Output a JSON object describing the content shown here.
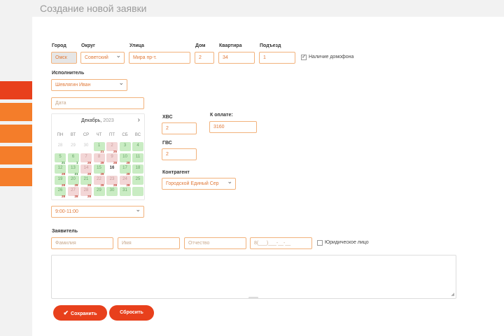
{
  "page": {
    "title": "Создание новой заявки"
  },
  "address": {
    "city": {
      "label": "Город",
      "value": "Омск"
    },
    "district": {
      "label": "Округ",
      "value": "Советский"
    },
    "street": {
      "label": "Улица",
      "value": "Мира пр-т."
    },
    "house": {
      "label": "Дом",
      "value": "2"
    },
    "apartment": {
      "label": "Квартира",
      "value": "34"
    },
    "entrance": {
      "label": "Подъезд",
      "value": "1"
    },
    "intercom": {
      "label": "Наличие домофона",
      "checked": true
    }
  },
  "executor": {
    "label": "Исполнитель",
    "value": "Шевлягин Иван"
  },
  "date_field": {
    "placeholder": "Дата"
  },
  "calendar": {
    "month": "Декабрь,",
    "year": "2023",
    "next": "›",
    "weekdays": [
      "ПН",
      "ВТ",
      "СР",
      "ЧТ",
      "ПТ",
      "СБ",
      "ВС"
    ],
    "weeks": [
      [
        {
          "d": "28",
          "s": "out"
        },
        {
          "d": "29",
          "s": "out"
        },
        {
          "d": "30",
          "s": "out"
        },
        {
          "d": "1",
          "s": "green",
          "n": "21",
          "nc": "r"
        },
        {
          "d": "2",
          "s": "pink",
          "n": "25",
          "nc": "r"
        },
        {
          "d": "3",
          "s": "green"
        },
        {
          "d": "4",
          "s": "green"
        }
      ],
      [
        {
          "d": "5",
          "s": "green",
          "n": "21",
          "nc": "g"
        },
        {
          "d": "6",
          "s": "green",
          "n": "1",
          "nc": "g"
        },
        {
          "d": "7",
          "s": "pink",
          "n": "28",
          "nc": "r"
        },
        {
          "d": "8",
          "s": "pink",
          "n": "28",
          "nc": "r"
        },
        {
          "d": "9",
          "s": "pink",
          "n": "28",
          "nc": "r"
        },
        {
          "d": "10",
          "s": "green",
          "n": "28",
          "nc": "r"
        },
        {
          "d": "11",
          "s": "green"
        }
      ],
      [
        {
          "d": "12",
          "s": "green",
          "n": "28",
          "nc": "r"
        },
        {
          "d": "13",
          "s": "green",
          "n": "21",
          "nc": "g"
        },
        {
          "d": "14",
          "s": "pink",
          "n": "28",
          "nc": "r"
        },
        {
          "d": "15",
          "s": "green",
          "n": "28",
          "nc": "r"
        },
        {
          "d": "16",
          "s": "today"
        },
        {
          "d": "17",
          "s": "green",
          "n": "28",
          "nc": "r"
        },
        {
          "d": "18",
          "s": "green"
        }
      ],
      [
        {
          "d": "19",
          "s": "green",
          "n": "28",
          "nc": "r"
        },
        {
          "d": "20",
          "s": "green",
          "n": "28",
          "nc": "r"
        },
        {
          "d": "21",
          "s": "green",
          "n": "28",
          "nc": "r"
        },
        {
          "d": "22",
          "s": "pink",
          "n": "28",
          "nc": "r"
        },
        {
          "d": "23",
          "s": "pink",
          "n": "28",
          "nc": "r"
        },
        {
          "d": "24",
          "s": "pink",
          "n": "28",
          "nc": "r"
        },
        {
          "d": "25",
          "s": "green"
        }
      ],
      [
        {
          "d": "26",
          "s": "green",
          "n": "28",
          "nc": "r"
        },
        {
          "d": "27",
          "s": "pink",
          "n": "28",
          "nc": "r"
        },
        {
          "d": "28",
          "s": "pink",
          "n": "28",
          "nc": "r"
        },
        {
          "d": "29",
          "s": "green"
        },
        {
          "d": "30",
          "s": "green"
        },
        {
          "d": "31",
          "s": "green"
        },
        {
          "d": "",
          "s": "green"
        }
      ]
    ]
  },
  "time_slot": {
    "value": "9:00-11:00"
  },
  "meters": {
    "cold_water": {
      "label": "ХВС",
      "value": "2"
    },
    "hot_water": {
      "label": "ГВС",
      "value": "2"
    },
    "to_pay": {
      "label": "К оплате:",
      "value": "3160"
    }
  },
  "contractor": {
    "label": "Контрагент",
    "value": "Городской Единый Сер"
  },
  "applicant": {
    "label": "Заявитель",
    "last_name_placeholder": "Фамилия",
    "first_name_placeholder": "Имя",
    "patronymic_placeholder": "Отчество",
    "phone_placeholder": "8(___)___-__-__",
    "legal_entity": {
      "label": "Юридическое лицо",
      "checked": false
    }
  },
  "actions": {
    "save": "Сохранить",
    "reset": "Сбросить",
    "save_icon": "✔"
  },
  "colors": {
    "accent": "#e8401c",
    "orange": "#f47d2a",
    "field_border": "#f2b27c",
    "field_text": "#e07a3a"
  }
}
